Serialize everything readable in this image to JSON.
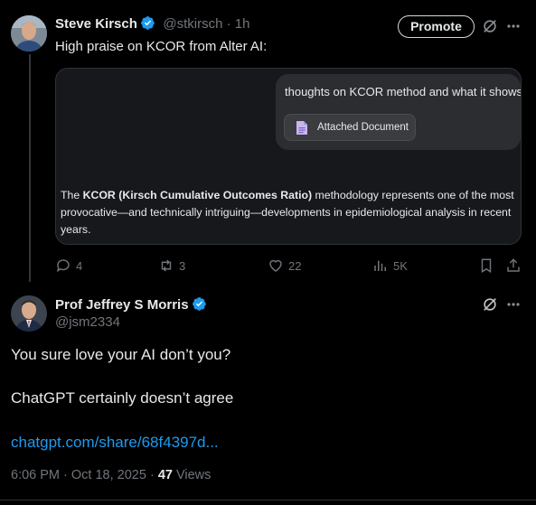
{
  "post1": {
    "author_name": "Steve Kirsch",
    "handle_time": "@stkirsch · 1h",
    "promote_label": "Promote",
    "text": "High praise on KCOR from Alter AI:",
    "card": {
      "question": "thoughts on KCOR method and what it shows?",
      "attachment_label": "Attached Document",
      "answer_prefix": "The ",
      "answer_bold": "KCOR (Kirsch Cumulative Outcomes Ratio)",
      "answer_rest": " methodology represents one of the most provocative—and technically intriguing—developments in epidemiological analysis in recent years."
    },
    "actions": {
      "replies": "4",
      "reposts": "3",
      "likes": "22",
      "views": "5K"
    }
  },
  "post2": {
    "author_name": "Prof Jeffrey S Morris",
    "handle": "@jsm2334",
    "line1": "You sure love your AI don’t you?",
    "line2": "ChatGPT certainly doesn’t agree",
    "link": "chatgpt.com/share/68f4397d...",
    "meta_time": "6:06 PM · Oct 18, 2025 · ",
    "views_count": "47",
    "views_label": " Views"
  },
  "colors": {
    "background": "#000000",
    "verified": "#1d9bf0",
    "link": "#1d9bf0",
    "muted": "#71767b"
  },
  "icons": [
    "verified-badge-icon",
    "grok-icon",
    "more-icon",
    "document-icon",
    "reply-icon",
    "repost-icon",
    "like-icon",
    "views-icon",
    "bookmark-icon",
    "share-icon"
  ]
}
